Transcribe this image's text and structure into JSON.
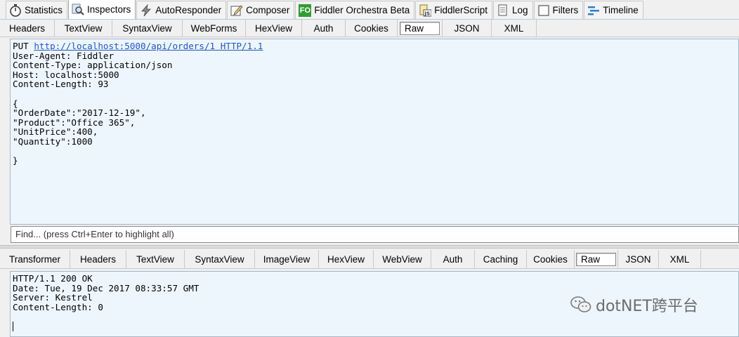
{
  "top_tabs": [
    {
      "label": "Statistics",
      "icon": "stopwatch-icon"
    },
    {
      "label": "Inspectors",
      "icon": "magnifier-icon",
      "active": true
    },
    {
      "label": "AutoResponder",
      "icon": "lightning-icon"
    },
    {
      "label": "Composer",
      "icon": "compose-icon"
    },
    {
      "label": "Fiddler Orchestra Beta",
      "icon": "fo-icon",
      "icon_text": "FO"
    },
    {
      "label": "FiddlerScript",
      "icon": "js-script-icon",
      "icon_text": "JS"
    },
    {
      "label": "Log",
      "icon": "log-icon"
    },
    {
      "label": "Filters",
      "icon": "checkbox-icon"
    },
    {
      "label": "Timeline",
      "icon": "timeline-icon"
    }
  ],
  "request_tabs": [
    "Headers",
    "TextView",
    "SyntaxView",
    "WebForms",
    "HexView",
    "Auth",
    "Cookies",
    "Raw",
    "JSON",
    "XML"
  ],
  "request_active_tab": "Raw",
  "request": {
    "method": "PUT",
    "url": "http://localhost:5000/api/orders/1 HTTP/1.1",
    "headers": [
      "User-Agent: Fiddler",
      "Content-Type: application/json",
      "Host: localhost:5000",
      "Content-Length: 93"
    ],
    "body": [
      "{",
      "\"OrderDate\":\"2017-12-19\",",
      "\"Product\":\"Office 365\",",
      "\"UnitPrice\":400,",
      "\"Quantity\":1000",
      "",
      "}"
    ]
  },
  "find": {
    "placeholder": "Find... (press Ctrl+Enter to highlight all)"
  },
  "response_tabs": [
    "Transformer",
    "Headers",
    "TextView",
    "SyntaxView",
    "ImageView",
    "HexView",
    "WebView",
    "Auth",
    "Caching",
    "Cookies",
    "Raw",
    "JSON",
    "XML"
  ],
  "response_active_tab": "Raw",
  "response": {
    "lines": [
      "HTTP/1.1 200 OK",
      "Date: Tue, 19 Dec 2017 08:33:57 GMT",
      "Server: Kestrel",
      "Content-Length: 0"
    ]
  },
  "watermark": {
    "text": "dotNET跨平台"
  },
  "colors": {
    "pane_bg": "#eef6fd",
    "link": "#1a55d6",
    "fo_green": "#2e9e2e"
  }
}
